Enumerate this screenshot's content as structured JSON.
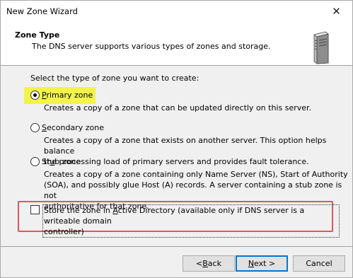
{
  "window": {
    "title": "New Zone Wizard",
    "close_glyph": "✕"
  },
  "header": {
    "title": "Zone Type",
    "subtitle": "The DNS server supports various types of zones and storage.",
    "icon": "server-icon"
  },
  "body": {
    "prompt": "Select the type of zone you want to create:",
    "options": [
      {
        "accel": "P",
        "label_rest": "rimary zone",
        "checked": true,
        "description": [
          "Creates a copy of a zone that can be updated directly on this server."
        ]
      },
      {
        "accel": "S",
        "label_rest": "econdary zone",
        "checked": false,
        "description": [
          "Creates a copy of a zone that exists on another server. This option helps balance",
          "the processing load of primary servers and provides fault tolerance."
        ]
      },
      {
        "label_pre": "St",
        "accel": "u",
        "label_rest": "b zone",
        "checked": false,
        "description": [
          "Creates a copy of a zone containing only Name Server (NS), Start of Authority",
          "(SOA), and possibly glue Host (A) records. A server containing a stub zone is not",
          "authoritative for that zone."
        ]
      }
    ],
    "store_ad": {
      "checked": false,
      "label_pre": "Store the zone in ",
      "accel": "A",
      "label_rest1": "ctive Directory (available only if DNS server is a writeable domain",
      "label_rest2": "controller)"
    }
  },
  "buttons": {
    "back_pre": "< ",
    "back_accel": "B",
    "back_rest": "ack",
    "next_accel": "N",
    "next_rest": "ext >",
    "cancel": "Cancel"
  },
  "colors": {
    "highlight": "#f3f34a",
    "annotation_box": "#e8525a",
    "default_button_border": "#0078d7"
  }
}
